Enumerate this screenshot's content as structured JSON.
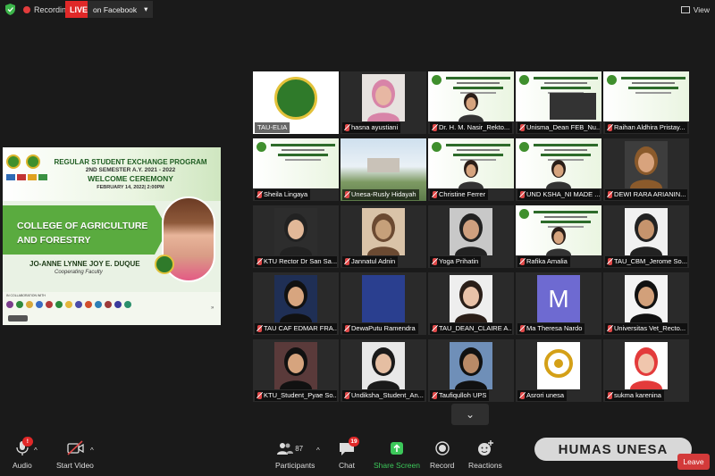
{
  "topbar": {
    "recording": "Recording",
    "live": "LIVE",
    "live_target": "on Facebook",
    "view": "View"
  },
  "shared_screen": {
    "program": "REGULAR STUDENT EXCHANGE PROGRAM",
    "semester": "2ND SEMESTER A.Y. 2021 - 2022",
    "ceremony": "WELCOME CEREMONY",
    "date": "FEBRUARY 14, 2022| 2:00PM",
    "college_line1": "COLLEGE OF AGRICULTURE",
    "college_line2": "AND FORESTRY",
    "person": "JO-ANNE LYNNE JOY E. DUQUE",
    "role": "Cooperating Faculty",
    "collab": "IN COLLABORATION WITH"
  },
  "participants": [
    {
      "name": "TAU-ELIA",
      "muted": false
    },
    {
      "name": "hasna ayustiani",
      "muted": true
    },
    {
      "name": "Dr. H. M. Nasir_Rekto...",
      "muted": true
    },
    {
      "name": "Unisma_Dean FEB_Nu...",
      "muted": true
    },
    {
      "name": "Raihan Aldhira Pristay...",
      "muted": true
    },
    {
      "name": "Sheila Lingaya",
      "muted": true
    },
    {
      "name": "Unesa-Rusly Hidayah",
      "muted": true
    },
    {
      "name": "Christine Ferrer",
      "muted": true
    },
    {
      "name": "UND KSHA_NI MADE ...",
      "muted": true
    },
    {
      "name": "DEWI RARA ARIANIN...",
      "muted": true
    },
    {
      "name": "KTU Rector Dr San Sa...",
      "muted": true
    },
    {
      "name": "Jannatul Adnin",
      "muted": true
    },
    {
      "name": "Yoga Prihatin",
      "muted": true
    },
    {
      "name": "Rafika Amalia",
      "muted": true
    },
    {
      "name": "TAU_CBM_Jerome So...",
      "muted": true
    },
    {
      "name": "TAU CAF EDMAR FRA...",
      "muted": true
    },
    {
      "name": "DewaPutu Ramendra",
      "muted": true
    },
    {
      "name": "TAU_DEAN_CLAIRE A...",
      "muted": true
    },
    {
      "name": "Ma Theresa Nardo",
      "muted": true
    },
    {
      "name": "Universitas Vet_Recto...",
      "muted": true
    },
    {
      "name": "KTU_Student_Pyae So...",
      "muted": true
    },
    {
      "name": "Undiksha_Student_An...",
      "muted": true
    },
    {
      "name": "Taufiqulloh UPS",
      "muted": true
    },
    {
      "name": "Asrori unesa",
      "muted": true
    },
    {
      "name": "sukma karenina",
      "muted": true
    }
  ],
  "avatar_letter": "M",
  "pager": "⌄",
  "toolbar": {
    "audio": "Audio",
    "start_video": "Start Video",
    "participants": "Participants",
    "participants_count": "87",
    "chat": "Chat",
    "chat_badge": "19",
    "share_screen": "Share Screen",
    "record": "Record",
    "reactions": "Reactions",
    "leave": "Leave"
  },
  "watermark": "HUMAS UNESA",
  "colors": {
    "live": "#e02828",
    "active_speaker": "#c9d845",
    "share_green": "#3cc85a",
    "leave": "#d33a3a"
  }
}
